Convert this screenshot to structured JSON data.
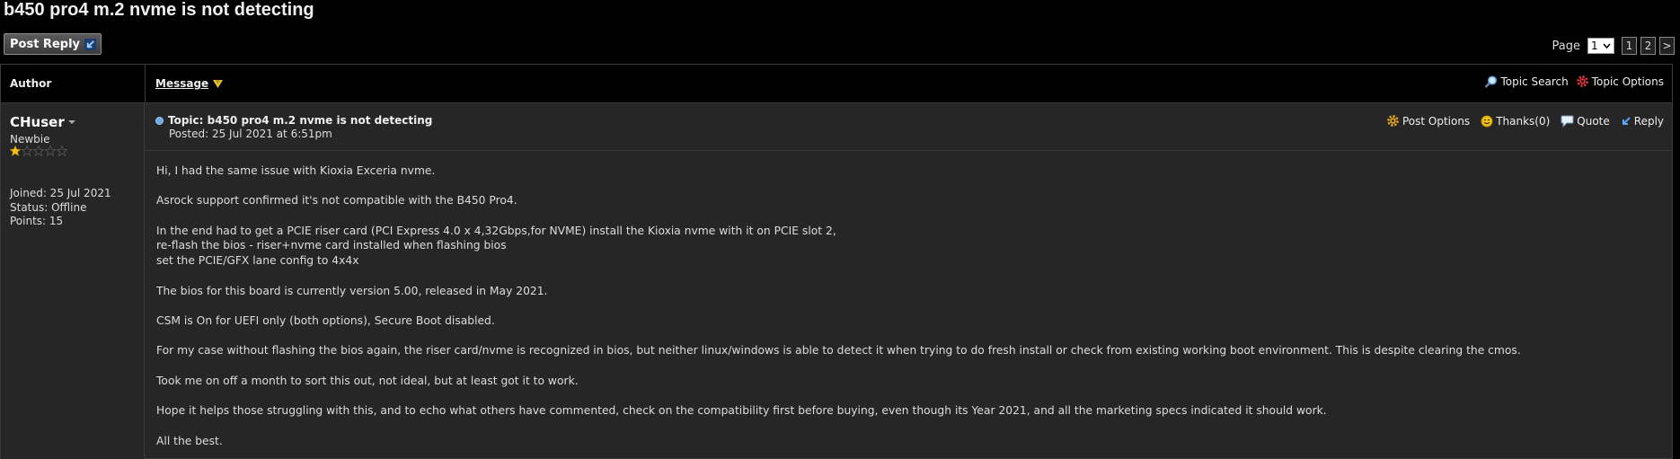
{
  "page": {
    "title": "b450 pro4 m.2 nvme is not detecting"
  },
  "toolbar": {
    "post_reply_label": "Post Reply"
  },
  "pager": {
    "label": "Page",
    "selected": "1",
    "pages": [
      "1",
      "2",
      ">"
    ]
  },
  "header": {
    "author_label": "Author",
    "message_label": "Message",
    "topic_search": "Topic Search",
    "topic_options": "Topic Options"
  },
  "author": {
    "name": "CHuser",
    "rank": "Newbie",
    "stars_filled": 1,
    "stars_total": 5,
    "joined": "Joined: 25 Jul 2021",
    "status": "Status: Offline",
    "points": "Points: 15"
  },
  "post": {
    "topic": "Topic: b450 pro4 m.2 nvme is not detecting",
    "posted": "Posted: 25 Jul 2021 at 6:51pm",
    "actions": {
      "options": "Post Options",
      "thanks": "Thanks(0)",
      "quote": "Quote",
      "reply": "Reply"
    },
    "lines": [
      "Hi, I had the same issue with Kioxia Exceria nvme.",
      "",
      "Asrock support confirmed it's not compatible with the B450 Pro4.",
      "",
      "In the end had to get a PCIE riser card (PCI Express 4.0 x 4,32Gbps,for NVME) install the Kioxia nvme with it on PCIE slot 2,",
      "re-flash the bios - riser+nvme card installed when flashing bios",
      "set the PCIE/GFX lane config to 4x4x",
      "",
      "The bios for this board is currently version 5.00, released in May 2021.",
      "",
      "CSM is On for UEFI only (both options), Secure Boot disabled.",
      "",
      "For my case without flashing the bios again, the riser card/nvme is recognized in bios, but neither linux/windows is able to detect it when trying to do fresh install or check from existing working boot environment. This is despite clearing the cmos.",
      "",
      "Took me on off a month to sort this out, not ideal, but at least got it to work.",
      "",
      "Hope it helps those struggling with this, and to echo what others have commented, check on the compatibility first before buying, even though its Year 2021, and all the marketing specs indicated it should work.",
      "",
      "All the best."
    ]
  },
  "colors": {
    "star": "#f2c318",
    "link_blue": "#6ea9e3",
    "sort_arrow": "#e9c12a"
  }
}
